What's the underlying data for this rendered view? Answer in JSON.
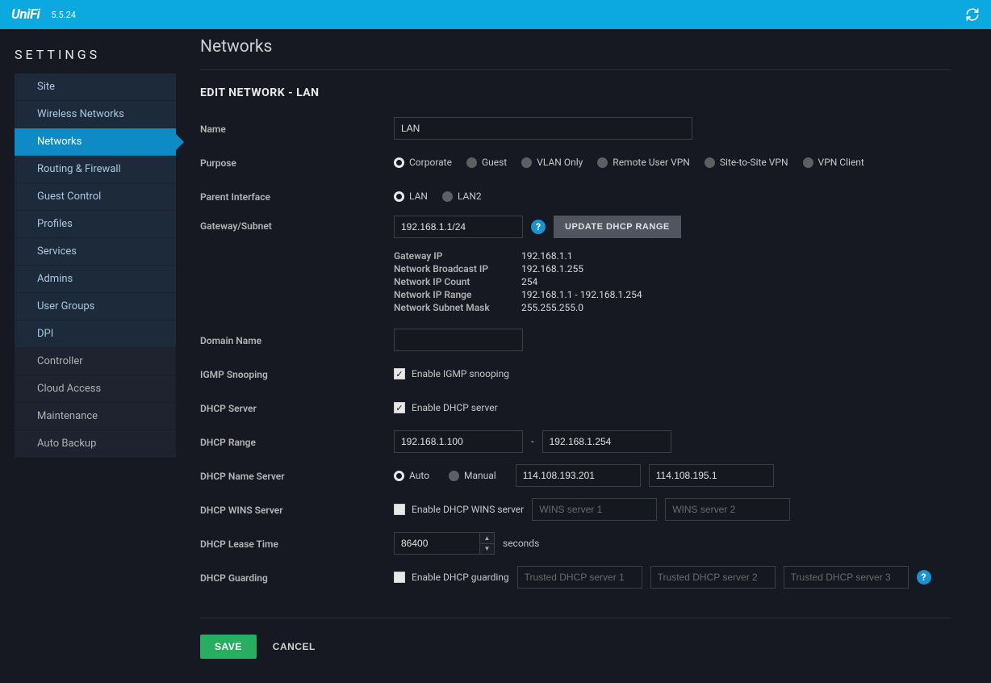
{
  "app": {
    "brand": "UniFi",
    "version": "5.5.24"
  },
  "sidebar": {
    "title": "SETTINGS",
    "primary": [
      "Site",
      "Wireless Networks",
      "Networks",
      "Routing & Firewall",
      "Guest Control",
      "Profiles",
      "Services",
      "Admins",
      "User Groups",
      "DPI"
    ],
    "secondary": [
      "Controller",
      "Cloud Access",
      "Maintenance",
      "Auto Backup"
    ],
    "active": "Networks"
  },
  "page": {
    "heading": "Networks",
    "section": "EDIT NETWORK - LAN",
    "labels": {
      "name": "Name",
      "purpose": "Purpose",
      "parent": "Parent Interface",
      "gateway": "Gateway/Subnet",
      "domain": "Domain Name",
      "igmp": "IGMP Snooping",
      "dhcp": "DHCP Server",
      "range": "DHCP Range",
      "ns": "DHCP Name Server",
      "wins": "DHCP WINS Server",
      "lease": "DHCP Lease Time",
      "guard": "DHCP Guarding"
    },
    "name_value": "LAN",
    "purpose_options": [
      "Corporate",
      "Guest",
      "VLAN Only",
      "Remote User VPN",
      "Site-to-Site VPN",
      "VPN Client"
    ],
    "purpose_selected": "Corporate",
    "parent_options": [
      "LAN",
      "LAN2"
    ],
    "parent_selected": "LAN",
    "gateway_value": "192.168.1.1/24",
    "update_range_btn": "UPDATE DHCP RANGE",
    "gateway_info": [
      {
        "k": "Gateway IP",
        "v": "192.168.1.1"
      },
      {
        "k": "Network Broadcast IP",
        "v": "192.168.1.255"
      },
      {
        "k": "Network IP Count",
        "v": "254"
      },
      {
        "k": "Network IP Range",
        "v": "192.168.1.1 - 192.168.1.254"
      },
      {
        "k": "Network Subnet Mask",
        "v": "255.255.255.0"
      }
    ],
    "domain_value": "",
    "igmp_check": "Enable IGMP snooping",
    "dhcp_check": "Enable DHCP server",
    "range_start": "192.168.1.100",
    "range_end": "192.168.1.254",
    "ns_modes": [
      "Auto",
      "Manual"
    ],
    "ns_selected": "Auto",
    "ns1": "114.108.193.201",
    "ns2": "114.108.195.1",
    "wins_check": "Enable DHCP WINS server",
    "wins1_ph": "WINS server 1",
    "wins2_ph": "WINS server 2",
    "lease_value": "86400",
    "lease_unit": "seconds",
    "guard_check": "Enable DHCP guarding",
    "guard1_ph": "Trusted DHCP server 1",
    "guard2_ph": "Trusted DHCP server 2",
    "guard3_ph": "Trusted DHCP server 3",
    "save": "SAVE",
    "cancel": "CANCEL"
  }
}
